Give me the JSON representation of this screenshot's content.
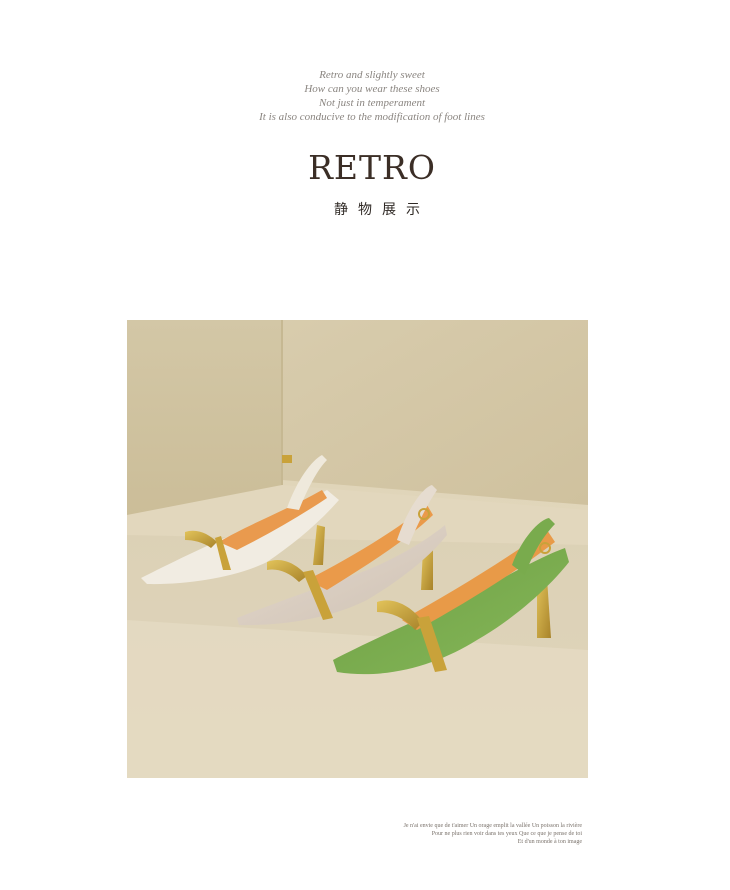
{
  "tagline": [
    "Retro and slightly sweet",
    "How can you wear these shoes",
    "Not just in temperament",
    "It is also conducive to the modification of foot lines"
  ],
  "title": "RETRO",
  "subtitle": "静物展示",
  "caption": [
    "Je n'ai envie que de t'aimer Un orage emplit la vallée Un poisson la rivière",
    "Pour ne plus rien voir dans tes yeux Que ce que je pense de toi",
    "Et d'un monde à ton image"
  ],
  "photo": {
    "subject": "three pointed slingback heels: white, beige, green",
    "colors": {
      "background": "#d6c8a6",
      "white_shoe": "#f1ece2",
      "beige_shoe": "#ddd1c4",
      "green_shoe": "#76a84a",
      "lining": "#e79a4c",
      "gold": "#c9a23a"
    }
  }
}
